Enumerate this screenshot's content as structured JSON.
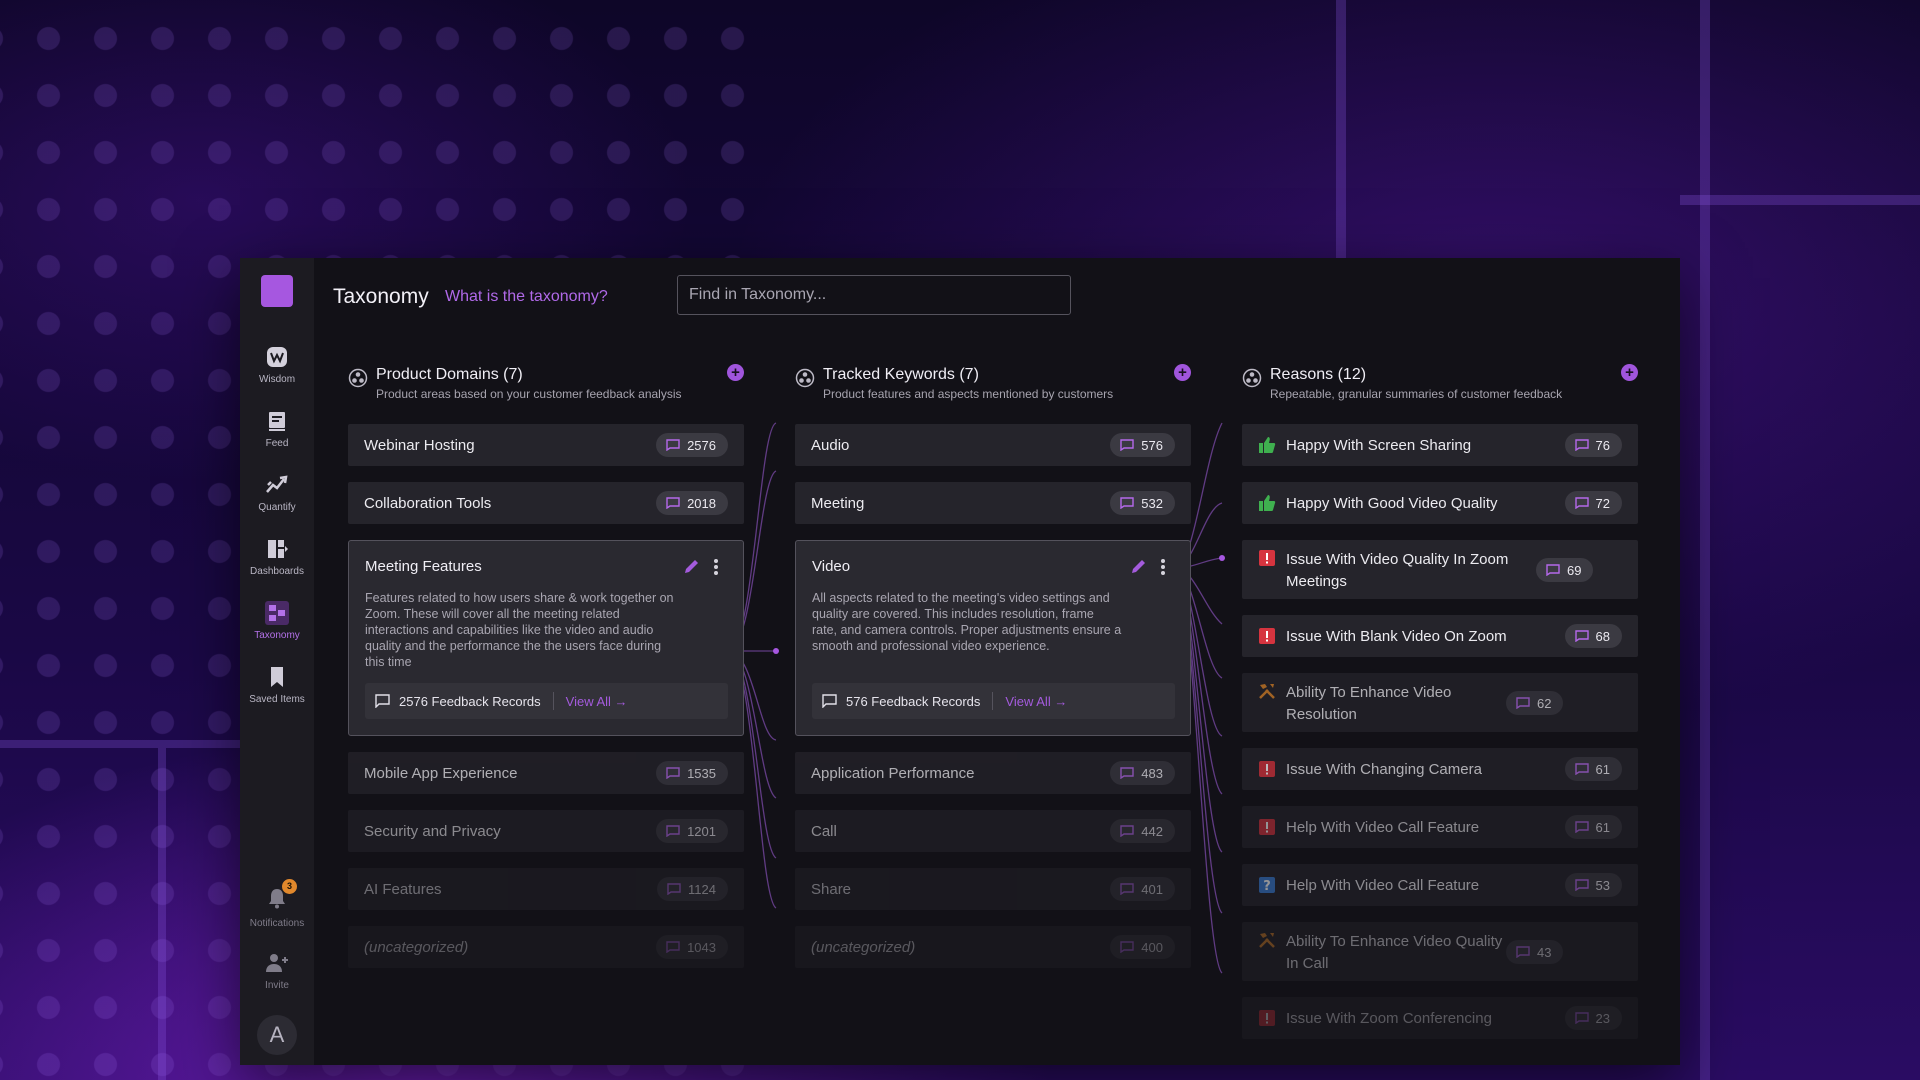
{
  "sidebar": {
    "items": [
      {
        "label": "Wisdom",
        "icon": "wisdom-icon"
      },
      {
        "label": "Feed",
        "icon": "feed-icon"
      },
      {
        "label": "Quantify",
        "icon": "quantify-icon"
      },
      {
        "label": "Dashboards",
        "icon": "dashboards-icon"
      },
      {
        "label": "Taxonomy",
        "icon": "taxonomy-icon",
        "active": true
      },
      {
        "label": "Saved Items",
        "icon": "bookmark-icon"
      }
    ],
    "notifications_label": "Notifications",
    "notifications_count": "3",
    "invite_label": "Invite",
    "avatar_initial": "A"
  },
  "header": {
    "title": "Taxonomy",
    "help_link": "What is the taxonomy?",
    "search_placeholder": "Find in Taxonomy..."
  },
  "columns": {
    "domains": {
      "title": "Product Domains (7)",
      "subtitle": "Product areas based on your customer feedback analysis",
      "items": [
        {
          "label": "Webinar Hosting",
          "count": "2576"
        },
        {
          "label": "Collaboration Tools",
          "count": "2018"
        },
        {
          "label": "Mobile App Experience",
          "count": "1535"
        },
        {
          "label": "Security and Privacy",
          "count": "1201"
        },
        {
          "label": "AI Features",
          "count": "1124"
        },
        {
          "label": "(uncategorized)",
          "count": "1043"
        }
      ],
      "card": {
        "title": "Meeting Features",
        "description": "Features related to how users share & work together on Zoom. These will cover all the meeting related interactions and capabilities like the video and audio quality and the performance the the users face during this time",
        "records": "2576 Feedback Records",
        "view_all": "View All →"
      }
    },
    "keywords": {
      "title": "Tracked Keywords (7)",
      "subtitle": "Product features and aspects mentioned by customers",
      "items": [
        {
          "label": "Audio",
          "count": "576"
        },
        {
          "label": "Meeting",
          "count": "532"
        },
        {
          "label": "Application Performance",
          "count": "483"
        },
        {
          "label": "Call",
          "count": "442"
        },
        {
          "label": "Share",
          "count": "401"
        },
        {
          "label": "(uncategorized)",
          "count": "400"
        }
      ],
      "card": {
        "title": "Video",
        "description": "All aspects related to the meeting's video settings and quality are covered. This includes resolution, frame rate, and camera controls. Proper adjustments ensure a smooth and professional video experience.",
        "records": "576 Feedback Records",
        "view_all": "View All →"
      }
    },
    "reasons": {
      "title": "Reasons (12)",
      "subtitle": "Repeatable, granular summaries of customer feedback",
      "items": [
        {
          "label": "Happy With Screen Sharing",
          "count": "76",
          "icon": "thumbs-up-icon"
        },
        {
          "label": "Happy With Good Video Quality",
          "count": "72",
          "icon": "thumbs-up-icon"
        },
        {
          "label": "Issue With Video Quality In Zoom Meetings",
          "count": "69",
          "icon": "issue-icon"
        },
        {
          "label": "Issue With Blank Video On Zoom",
          "count": "68",
          "icon": "issue-icon"
        },
        {
          "label": "Ability To Enhance Video Resolution",
          "count": "62",
          "icon": "tools-icon"
        },
        {
          "label": "Issue With Changing Camera",
          "count": "61",
          "icon": "issue-icon"
        },
        {
          "label": "Help With Video Call Feature",
          "count": "61",
          "icon": "issue-icon"
        },
        {
          "label": "Help With Video Call Feature",
          "count": "53",
          "icon": "help-icon"
        },
        {
          "label": "Ability To Enhance Video Quality In Call",
          "count": "43",
          "icon": "tools-icon"
        },
        {
          "label": "Issue With Zoom Conferencing",
          "count": "23",
          "icon": "issue-icon"
        }
      ]
    }
  },
  "colors": {
    "accent": "#a657e0",
    "positive": "#3fb04f",
    "issue": "#d6343f",
    "help": "#3a7fd6",
    "feature": "#d9832a"
  }
}
